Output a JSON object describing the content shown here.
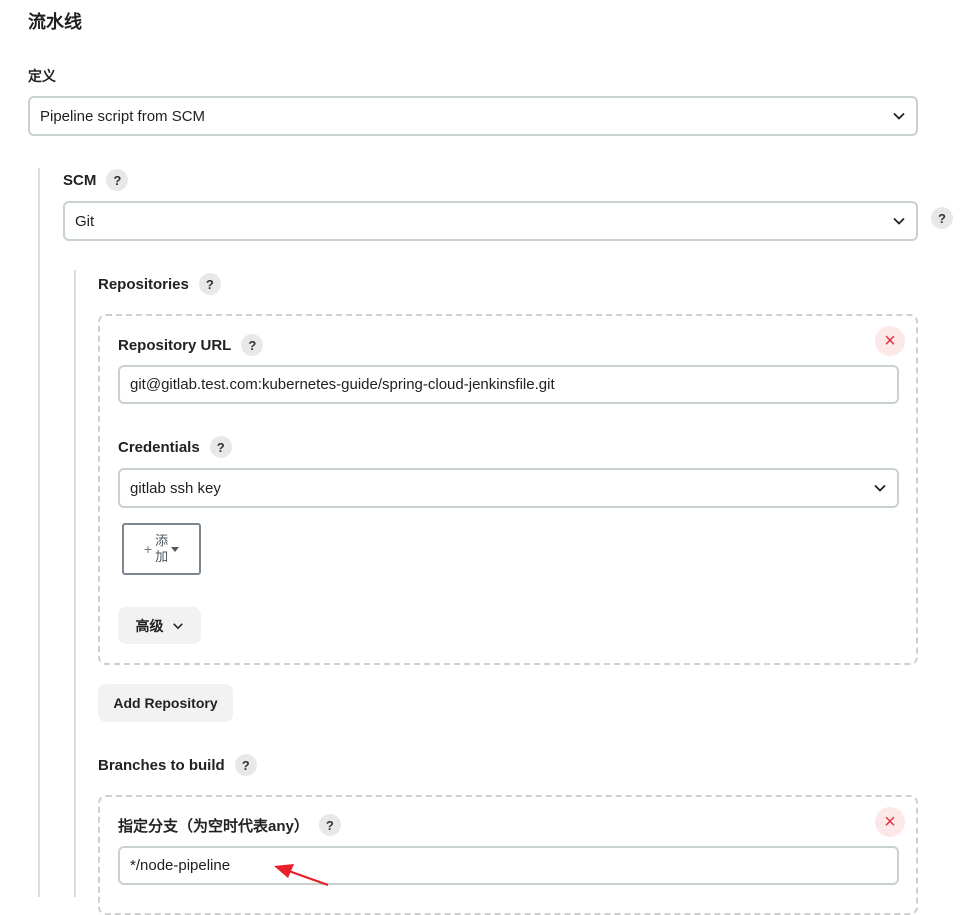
{
  "pipeline": {
    "section_title": "流水线",
    "definition_label": "定义",
    "definition_value": "Pipeline script from SCM"
  },
  "scm": {
    "label": "SCM",
    "value": "Git"
  },
  "repositories": {
    "label": "Repositories",
    "url_label": "Repository URL",
    "url_value": "git@gitlab.test.com:kubernetes-guide/spring-cloud-jenkinsfile.git",
    "credentials_label": "Credentials",
    "credentials_value": "gitlab ssh key",
    "add_button_line1": "添",
    "add_button_line2": "加",
    "advanced_label": "高级",
    "add_repository_label": "Add Repository",
    "remove_symbol": "×"
  },
  "branches": {
    "label": "Branches to build",
    "specifier_label": "指定分支（为空时代表any）",
    "specifier_value": "*/node-pipeline",
    "remove_symbol": "×"
  },
  "help_symbol": "?",
  "colors": {
    "field_border": "#c9d1cf",
    "remove_icon": "#e0323f",
    "remove_bg": "#fde8e9",
    "annotation_arrow": "#e8202a"
  }
}
